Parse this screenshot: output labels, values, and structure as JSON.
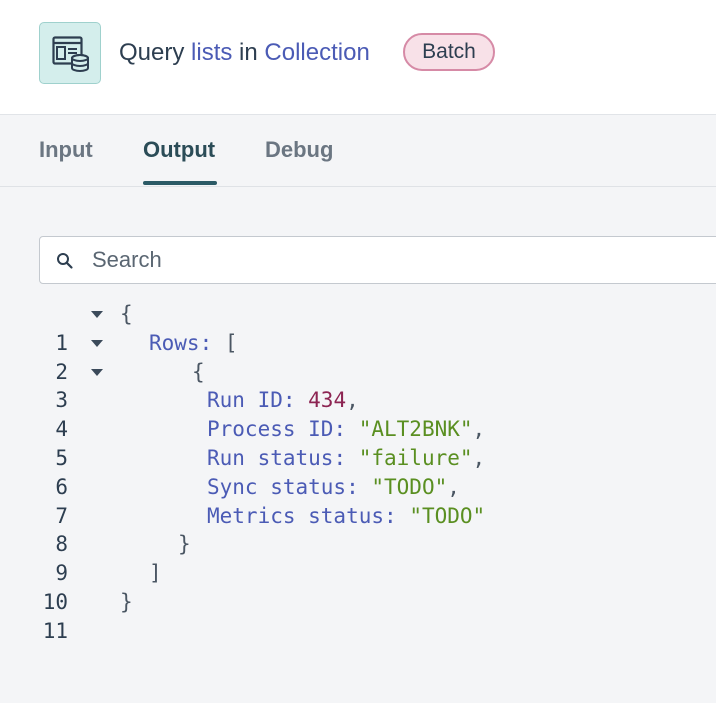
{
  "header": {
    "title_query": "Query",
    "title_object": "lists",
    "title_in": "in",
    "title_source": "Collection",
    "badge": "Batch",
    "icon": "table-database-icon"
  },
  "tabs": [
    {
      "label": "Input",
      "active": false
    },
    {
      "label": "Output",
      "active": true
    },
    {
      "label": "Debug",
      "active": false
    }
  ],
  "search": {
    "placeholder": "Search",
    "value": ""
  },
  "output_json": {
    "lines": [
      {
        "n": "1"
      },
      {
        "n": "2"
      },
      {
        "n": "3"
      },
      {
        "n": "4"
      },
      {
        "n": "5"
      },
      {
        "n": "6"
      },
      {
        "n": "7"
      },
      {
        "n": "8"
      },
      {
        "n": "9"
      },
      {
        "n": "10"
      },
      {
        "n": "11"
      }
    ],
    "rows_key": "Rows",
    "row": {
      "run_id_key": "Run ID",
      "run_id_val": "434",
      "process_id_key": "Process ID",
      "process_id_val": "\"ALT2BNK\"",
      "run_status_key": "Run status",
      "run_status_val": "\"failure\"",
      "sync_status_key": "Sync status",
      "sync_status_val": "\"TODO\"",
      "metrics_status_key": "Metrics status",
      "metrics_status_val": "\"TODO\""
    }
  },
  "colors": {
    "link": "#4b5bb5",
    "badge_bg": "#f8e1e8",
    "badge_border": "#d68aa6",
    "tab_active": "#2b4c57",
    "number": "#8c2452",
    "string": "#5a8f21"
  }
}
